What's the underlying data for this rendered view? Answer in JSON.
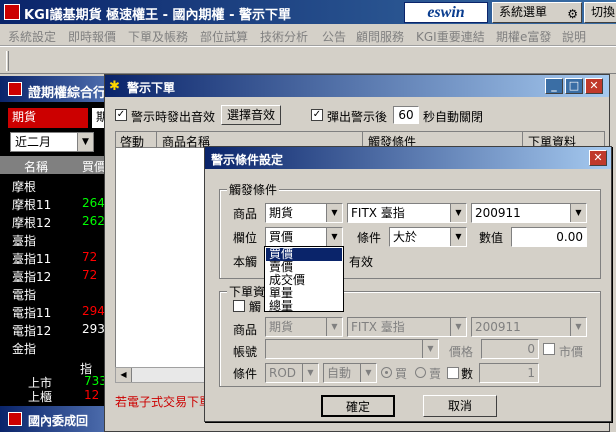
{
  "main_window": {
    "title": "KGI議基期貨 極速權王 - 國內期權 - 警示下單",
    "brand": "eswin",
    "system_menu_button": "系統選單",
    "switch_button": "切換"
  },
  "menubar": {
    "items": [
      "系統設定",
      "即時報價",
      "下單及帳務",
      "部位試算",
      "技術分析",
      "公告",
      "顧問服務",
      "KGI重要連結",
      "期權e富發",
      "說明"
    ]
  },
  "left_panel": {
    "title": "證期權綜合行",
    "tab_futures": "期貨",
    "tab_more": "期",
    "month": "近二月",
    "header_name": "名稱",
    "header_buy": "買價",
    "rows": [
      {
        "name": "摩根",
        "price": ""
      },
      {
        "name": "摩根11",
        "price": "264"
      },
      {
        "name": "摩根12",
        "price": "262"
      },
      {
        "name": "臺指",
        "price": ""
      },
      {
        "name": "臺指11",
        "price": "72"
      },
      {
        "name": "臺指12",
        "price": "72"
      },
      {
        "name": "電指",
        "price": ""
      },
      {
        "name": "電指11",
        "price": "294."
      },
      {
        "name": "電指12",
        "price": "293."
      },
      {
        "name": "金指",
        "price": ""
      }
    ],
    "price_colors": [
      "#ffffff",
      "#00ff00",
      "#00ff00",
      "#ffffff",
      "#ff0000",
      "#ff0000",
      "#ffffff",
      "#ff0000",
      "#ffffff",
      "#ffffff"
    ],
    "pi_label": "指",
    "up_label": "上市",
    "up_value": "733",
    "otc_label": "上櫃",
    "otc_value": "12",
    "bottom_title": "國內委成回"
  },
  "alert_window": {
    "title": "警示下單",
    "sound_checkbox_label": "警示時發出音效",
    "sound_checked": true,
    "choose_sound_button": "選擇音效",
    "popup_checkbox_label": "彈出警示後",
    "popup_checked": true,
    "auto_close_seconds": "60",
    "auto_close_suffix": "秒自動關閉",
    "grid_headers": [
      "啓動",
      "商品名稱",
      "觸發條件",
      "下單資料"
    ],
    "footer_text": "若電子式交易下單"
  },
  "condition_dialog": {
    "title": "警示條件設定",
    "trigger_group": {
      "label": "觸發條件",
      "product_label": "商品",
      "product_type": "期貨",
      "product_name": "FITX 臺指",
      "product_month": "200911",
      "field_label": "欄位",
      "field_value": "買價",
      "field_options": [
        "買價",
        "賣價",
        "成交價",
        "單量",
        "總量"
      ],
      "condition_label": "條件",
      "condition_value": "大於",
      "number_label": "數值",
      "number_value": "0.00",
      "note_prefix": "本觸",
      "note_suffix": "有效"
    },
    "order_group": {
      "label": "下單資",
      "checkbox_label": "觸",
      "checked": false,
      "product_label": "商品",
      "product_type": "期貨",
      "product_name": "FITX 臺指",
      "product_month": "200911",
      "account_label": "帳號",
      "account_value": "",
      "price_label": "價格",
      "price_value": "0",
      "market_label": "市價",
      "cond_label": "條件",
      "cond_rod": "ROD",
      "cond_auto": "自動",
      "buy_label": "買",
      "sell_label": "賣",
      "qty_label": "數",
      "qty_value": "1"
    },
    "ok_button": "確定",
    "cancel_button": "取消"
  }
}
